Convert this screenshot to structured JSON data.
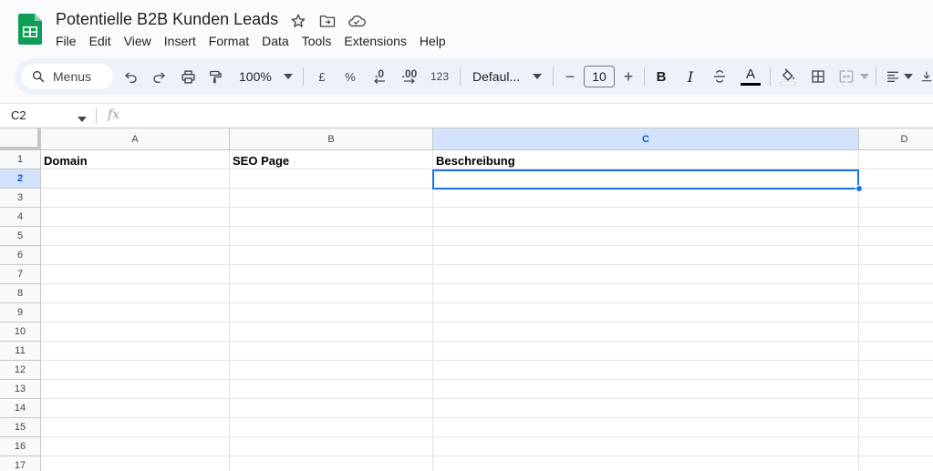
{
  "document": {
    "title": "Potentielle B2B Kunden Leads"
  },
  "menu": [
    "File",
    "Edit",
    "View",
    "Insert",
    "Format",
    "Data",
    "Tools",
    "Extensions",
    "Help"
  ],
  "toolbar": {
    "search_label": "Menus",
    "zoom": "100%",
    "currency": "£",
    "percent": "%",
    "decrease_decimal": ".0",
    "increase_decimal": ".00",
    "number_format": "123",
    "font_family": "Defaul...",
    "font_size": "10",
    "bold": "B",
    "italic": "I",
    "text_color": "A",
    "minus": "−",
    "plus": "+"
  },
  "formula_bar": {
    "name_box": "C2",
    "fx_label": "fx"
  },
  "grid": {
    "columns": [
      {
        "label": "A",
        "selected": false
      },
      {
        "label": "B",
        "selected": false
      },
      {
        "label": "C",
        "selected": true
      },
      {
        "label": "D",
        "selected": false
      }
    ],
    "rows": [
      "1",
      "2",
      "3",
      "4",
      "5",
      "6",
      "7",
      "8",
      "9",
      "10",
      "11",
      "12",
      "13",
      "14",
      "15",
      "16",
      "17"
    ],
    "selected_row": "2",
    "header_row": {
      "A": "Domain",
      "B": "SEO Page",
      "C": "Beschreibung"
    }
  },
  "colors": {
    "brand_green": "#0f9d58",
    "selection_blue": "#1a73e8",
    "header_selected_bg": "#d3e3fd"
  }
}
